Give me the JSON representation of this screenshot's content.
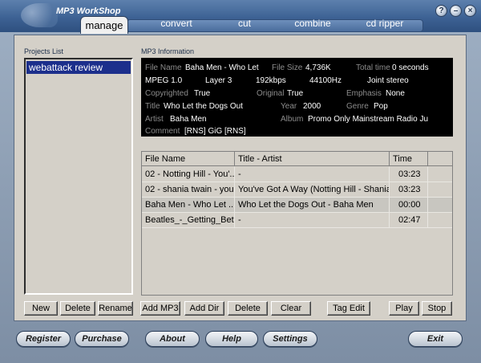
{
  "app": {
    "title": "MP3 WorkShop"
  },
  "window_controls": [
    "?",
    "–",
    "×"
  ],
  "tabs": [
    "manage",
    "convert",
    "cut",
    "combine",
    "cd ripper"
  ],
  "projects": {
    "label": "Projects List",
    "items": [
      "webattack review"
    ],
    "buttons": [
      "New",
      "Delete",
      "Rename"
    ]
  },
  "info": {
    "label": "MP3 Information",
    "file_name_label": "File Name",
    "file_name": "Baha Men - Who Let",
    "file_size_label": "File Size",
    "file_size": "4,736K",
    "total_time_label": "Total time",
    "total_time": "0 seconds",
    "mpeg": "MPEG 1.0",
    "layer": "Layer 3",
    "bitrate": "192kbps",
    "samplerate": "44100Hz",
    "mode": "Joint stereo",
    "copyrighted_label": "Copyrighted",
    "copyrighted": "True",
    "original_label": "Original",
    "original": "True",
    "emphasis_label": "Emphasis",
    "emphasis": "None",
    "title_label": "Title",
    "title": "Who Let the Dogs Out",
    "year_label": "Year",
    "year": "2000",
    "genre_label": "Genre",
    "genre": "Pop",
    "artist_label": "Artist",
    "artist": "Baha Men",
    "album_label": "Album",
    "album": "Promo Only Mainstream Radio Ju",
    "comment_label": "Comment",
    "comment": "[RNS] GiG [RNS]"
  },
  "table": {
    "headers": [
      "File Name",
      "Title - Artist",
      "Time"
    ],
    "rows": [
      {
        "file": "02 - Notting Hill - You'...",
        "title": "-",
        "time": "03:23"
      },
      {
        "file": "02 - shania twain - you...",
        "title": "You've Got A Way (Notting Hill - Shania...",
        "time": "03:23"
      },
      {
        "file": "Baha Men - Who Let ...",
        "title": "Who Let the Dogs Out - Baha Men",
        "time": "00:00"
      },
      {
        "file": "Beatles_-_Getting_Bet...",
        "title": "-",
        "time": "02:47"
      }
    ]
  },
  "file_buttons": [
    "Add MP3",
    "Add Dir",
    "Delete",
    "Clear",
    "Tag Edit",
    "Play",
    "Stop"
  ],
  "footer_buttons": [
    "Register",
    "Purchase",
    "About",
    "Help",
    "Settings",
    "Exit"
  ]
}
